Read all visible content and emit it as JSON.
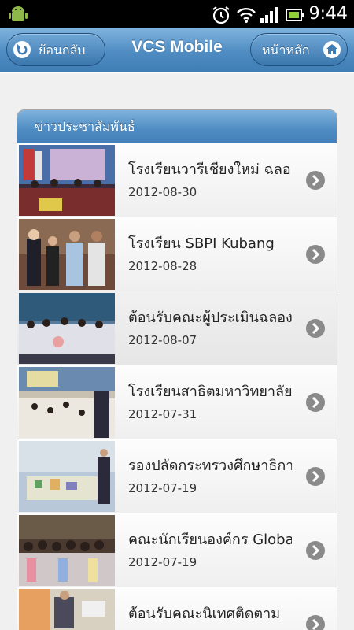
{
  "status_bar": {
    "time": "9:44",
    "icons": [
      "android-icon",
      "alarm-icon",
      "wifi-icon",
      "signal-icon",
      "battery-icon"
    ]
  },
  "header": {
    "title": "VCS Mobile",
    "back_label": "ย้อนกลับ",
    "home_label": "หน้าหลัก",
    "colors": {
      "bar": "#4f8cc2",
      "button": "#3b77ad"
    }
  },
  "news": {
    "heading": "ข่าวประชาสัมพันธ์",
    "items": [
      {
        "title": "โรงเรียนวารีเชียงใหม่ ฉลอง",
        "date": "2012-08-30"
      },
      {
        "title": "โรงเรียน SBPI Kubang",
        "date": "2012-08-28"
      },
      {
        "title": "ต้อนรับคณะผู้ประเมินฉลอง",
        "date": "2012-08-07"
      },
      {
        "title": "โรงเรียนสาธิตมหาวิทยาลัย",
        "date": "2012-07-31"
      },
      {
        "title": "รองปลัดกระทรวงศึกษาธิการ",
        "date": "2012-07-19"
      },
      {
        "title": "คณะนักเรียนองค์กร Global",
        "date": "2012-07-19"
      },
      {
        "title": "ต้อนรับคณะนิเทศติดตาม",
        "date": ""
      }
    ]
  }
}
